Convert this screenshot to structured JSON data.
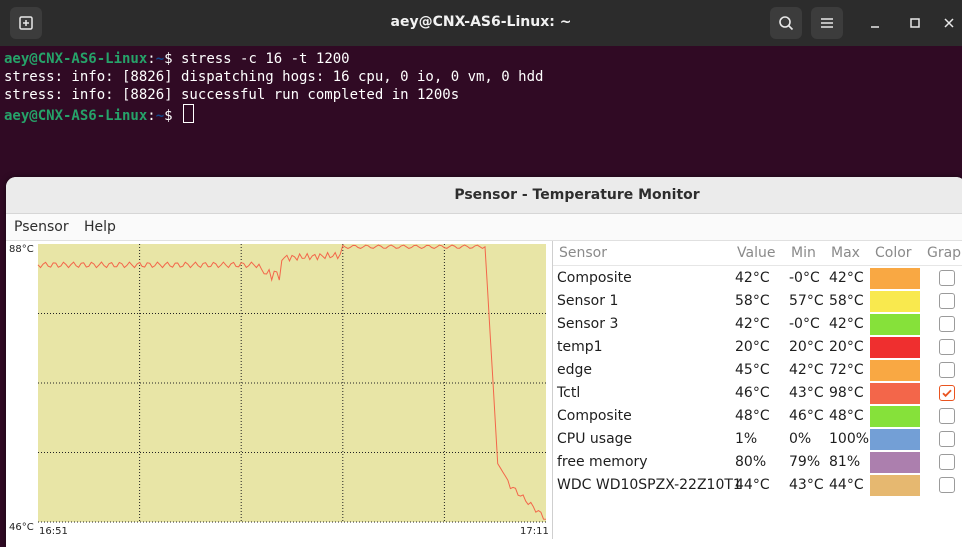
{
  "terminal": {
    "title": "aey@CNX-AS6-Linux: ~",
    "prompt_user": "aey@CNX-AS6-Linux",
    "prompt_sep": ":",
    "prompt_path": "~",
    "prompt_dollar": "$ ",
    "lines": [
      "stress -c 16 -t 1200",
      "stress: info: [8826] dispatching hogs: 16 cpu, 0 io, 0 vm, 0 hdd",
      "stress: info: [8826] successful run completed in 1200s"
    ]
  },
  "psensor": {
    "title": "Psensor - Temperature Monitor",
    "menu": [
      "Psensor",
      "Help"
    ],
    "graph": {
      "y_max_label": "88°C",
      "y_min_label": "46°C",
      "x_start_label": "16:51",
      "x_end_label": "17:11",
      "background": "#e8e5a6",
      "line_color": "#f3664a"
    },
    "table": {
      "headers": [
        "Sensor",
        "Value",
        "Min",
        "Max",
        "Color",
        "Graph"
      ],
      "rows": [
        {
          "sensor": "Composite",
          "value": "42°C",
          "min": "-0°C",
          "max": "42°C",
          "color": "#f9a843",
          "graph": false
        },
        {
          "sensor": "Sensor 1",
          "value": "58°C",
          "min": "57°C",
          "max": "58°C",
          "color": "#f9e94e",
          "graph": false
        },
        {
          "sensor": "Sensor 3",
          "value": "42°C",
          "min": "-0°C",
          "max": "42°C",
          "color": "#86e13a",
          "graph": false
        },
        {
          "sensor": "temp1",
          "value": "20°C",
          "min": "20°C",
          "max": "20°C",
          "color": "#ef2f2f",
          "graph": false
        },
        {
          "sensor": "edge",
          "value": "45°C",
          "min": "42°C",
          "max": "72°C",
          "color": "#f9a843",
          "graph": false
        },
        {
          "sensor": "Tctl",
          "value": "46°C",
          "min": "43°C",
          "max": "98°C",
          "color": "#f3664a",
          "graph": true
        },
        {
          "sensor": "Composite",
          "value": "48°C",
          "min": "46°C",
          "max": "48°C",
          "color": "#86e13a",
          "graph": false
        },
        {
          "sensor": "CPU usage",
          "value": "1%",
          "min": "0%",
          "max": "100%",
          "color": "#739fd6",
          "graph": false
        },
        {
          "sensor": "free memory",
          "value": "80%",
          "min": "79%",
          "max": "81%",
          "color": "#ac7fae",
          "graph": false
        },
        {
          "sensor": "WDC WD10SPZX-22Z10T1",
          "value": "44°C",
          "min": "43°C",
          "max": "44°C",
          "color": "#e6b870",
          "graph": false
        }
      ]
    }
  }
}
